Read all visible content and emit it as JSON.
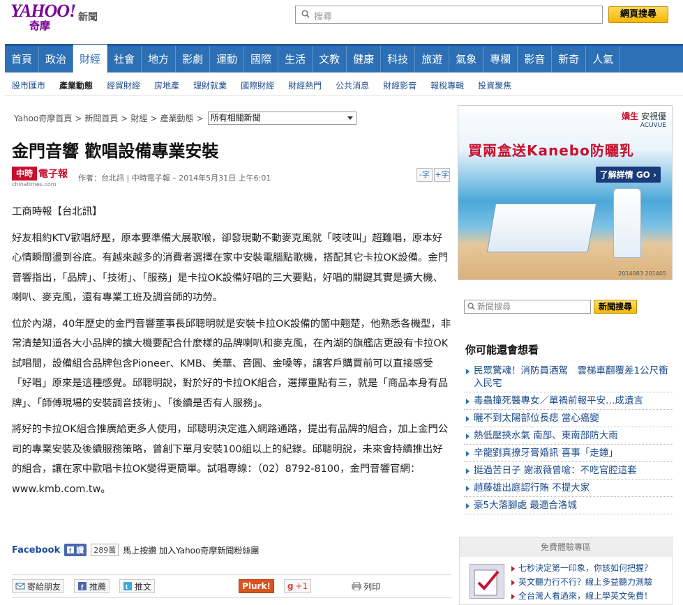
{
  "header": {
    "logo_main": "YAHOO!",
    "logo_sub": "奇摩",
    "section": "新聞",
    "search_placeholder": "搜尋",
    "search_button": "網頁搜尋"
  },
  "main_nav": [
    {
      "label": "首頁",
      "active": false
    },
    {
      "label": "政治",
      "active": false
    },
    {
      "label": "財經",
      "active": true
    },
    {
      "label": "社會",
      "active": false
    },
    {
      "label": "地方",
      "active": false
    },
    {
      "label": "影劇",
      "active": false
    },
    {
      "label": "運動",
      "active": false
    },
    {
      "label": "國際",
      "active": false
    },
    {
      "label": "生活",
      "active": false
    },
    {
      "label": "文教",
      "active": false
    },
    {
      "label": "健康",
      "active": false
    },
    {
      "label": "科技",
      "active": false
    },
    {
      "label": "旅遊",
      "active": false
    },
    {
      "label": "氣象",
      "active": false
    },
    {
      "label": "專欄",
      "active": false
    },
    {
      "label": "影音",
      "active": false
    },
    {
      "label": "新奇",
      "active": false
    },
    {
      "label": "人氣",
      "active": false
    }
  ],
  "sub_nav": [
    {
      "label": "股市匯市",
      "active": false
    },
    {
      "label": "產業動態",
      "active": true
    },
    {
      "label": "經貿財經",
      "active": false
    },
    {
      "label": "房地產",
      "active": false
    },
    {
      "label": "理財就業",
      "active": false
    },
    {
      "label": "國際財經",
      "active": false
    },
    {
      "label": "財經熱門",
      "active": false
    },
    {
      "label": "公共消息",
      "active": false
    },
    {
      "label": "財經影音",
      "active": false
    },
    {
      "label": "報稅專輯",
      "active": false
    },
    {
      "label": "投資聚焦",
      "active": false
    }
  ],
  "breadcrumb": {
    "items": [
      "Yahoo奇摩首頁",
      "新聞首頁",
      "財經",
      "產業動態"
    ],
    "separator": ">",
    "select_value": "所有相關新聞"
  },
  "article": {
    "title": "金門音響 歡唱設備專業安裝",
    "source_mark": "中時",
    "source_name": "電子報",
    "source_url": "chinatimes.com",
    "byline": "作者：台北訊 | 中時電子報 – 2014年5月31日 上午6:01",
    "font_smaller": "-字",
    "font_larger": "+字",
    "paragraphs": [
      "工商時報【台北訊】",
      "好友相約KTV歡唱紓壓，原本要準備大展歌喉，卻發現動不動麥克風就「吱吱叫」超難唱，原本好心情瞬間盪到谷底。有越來越多的消費者選擇在家中安裝電腦點歌機，搭配其它卡拉OK設備。金門音響指出，「品牌」、「技術」、「服務」是卡拉OK設備好唱的三大要點，好唱的關鍵其實是擴大機、喇叭、麥克風，還有專業工班及調音師的功勞。",
      "位於內湖，40年歷史的金門音響董事長邱聰明就是安裝卡拉OK設備的箇中翹楚，他熟悉各機型，非常清楚知道各大小品牌的擴大機要配合什麼樣的品牌喇叭和麥克風，在內湖的旗艦店更設有卡拉OK試唱間，設備組合品牌包含Pioneer、KMB、美華、音圓、金嗓等，讓客戶購買前可以直接感受「好唱」原來是這種感覺。邱聰明說，對於好的卡拉OK組合，選擇重點有三，就是「商品本身有品牌」、「師傅現場的安裝調音技術」、「後續是否有人服務」。",
      "將好的卡拉OK組合推廣給更多人使用，邱聰明決定進入網路通路，提出有品牌的組合，加上金門公司的專業安裝及後續服務策略，曾創下單月安裝100組以上的紀錄。邱聰明說，未來會持續推出好的組合，讓在家中歡唱卡拉OK變得更簡單。試唱專線：（02）8792-8100，金門音響官網：www.kmb.com.tw。"
    ]
  },
  "social": {
    "facebook_label": "Facebook",
    "like_label": "讚",
    "like_count": "289萬",
    "like_text": "馬上按讚 加入Yahoo奇摩新聞粉絲團"
  },
  "share": {
    "email": "寄給朋友",
    "recommend": "推薦",
    "tweet": "推文",
    "plurk": "Plurk!",
    "gplus": "+1",
    "print": "列印"
  },
  "ad": {
    "brand_prefix": "嬌生",
    "brand": "安視優",
    "brand_en": "ACUVUE",
    "headline": "買兩盒送Kanebo防曬乳",
    "cta": "了解詳情 GO ›",
    "code": "2014083 201405"
  },
  "sidebar": {
    "search_placeholder": "新聞搜尋",
    "search_button": "新聞搜尋",
    "related_title": "你可能還會想看",
    "related": [
      "民眾驚魂！消防員酒駕　雲梯車翻覆差1公尺衝入民宅",
      "毒蟲撞死醫專女／單禍前報平安…成遺言",
      "曬不到太陽部位長痣 當心癌變",
      "熱低壓挾水氣 南部、東南部防大雨",
      "辛龍劉真撩牙膏婚訊 喜事「走鐘」",
      "挺過苦日子 謝淑薇曾嗆：不吃官腔這套",
      "趙藤雄出庭認行賄 不提大家",
      "豪5大落腳處 最適合洛城"
    ],
    "free_title": "免費體驗專區",
    "free_items": [
      "七秒決定第一印象，你該如何把握？",
      "英文聽力行不行？線上多益聽力測驗",
      "全台灣人看過來，線上學英文免費！"
    ]
  }
}
